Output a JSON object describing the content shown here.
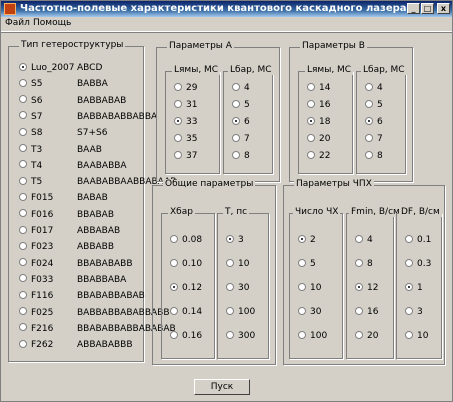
{
  "window": {
    "title": "Частотно-полевые характеристики квантового каскадного лазера",
    "minimize": "_",
    "maximize": "□",
    "close": "x"
  },
  "menu": [
    "Файл",
    "Помощь"
  ],
  "structure": {
    "title": "Тип гетероструктуры",
    "items": [
      {
        "name": "Luo_2007",
        "seq": "ABCD",
        "selected": true
      },
      {
        "name": "S5",
        "seq": "BABBA"
      },
      {
        "name": "S6",
        "seq": "BABBABAB"
      },
      {
        "name": "S7",
        "seq": "BABBABABBABBA"
      },
      {
        "name": "S8",
        "seq": "S7+S6"
      },
      {
        "name": "T3",
        "seq": "BAAB"
      },
      {
        "name": "T4",
        "seq": "BAABABBA"
      },
      {
        "name": "T5",
        "seq": "BAABABBAABBABAAB"
      },
      {
        "name": "F015",
        "seq": "BABAB"
      },
      {
        "name": "F016",
        "seq": "BBABAB"
      },
      {
        "name": "F017",
        "seq": "ABBABAB"
      },
      {
        "name": "F023",
        "seq": "ABBABB"
      },
      {
        "name": "F024",
        "seq": "BBABABABB"
      },
      {
        "name": "F033",
        "seq": "BBABBABA"
      },
      {
        "name": "F116",
        "seq": "BBABABBABAB"
      },
      {
        "name": "F025",
        "seq": "BABBABBABABBABB"
      },
      {
        "name": "F216",
        "seq": "BBABABBABBABABAB"
      },
      {
        "name": "F262",
        "seq": "ABBABABBB"
      }
    ]
  },
  "paramsA": {
    "title": "Параметры A",
    "col1": {
      "label": "Lямы, МС",
      "options": [
        "29",
        "31",
        "33",
        "35",
        "37"
      ],
      "selected": 2
    },
    "col2": {
      "label": "Lбар, МС",
      "options": [
        "4",
        "5",
        "6",
        "7",
        "8"
      ],
      "selected": 2
    }
  },
  "paramsB": {
    "title": "Параметры B",
    "col1": {
      "label": "Lямы, МС",
      "options": [
        "14",
        "16",
        "18",
        "20",
        "22"
      ],
      "selected": 2
    },
    "col2": {
      "label": "Lбар, МС",
      "options": [
        "4",
        "5",
        "6",
        "7",
        "8"
      ],
      "selected": 2
    }
  },
  "common": {
    "title": "Общие параметры",
    "col1": {
      "label": "Xбар",
      "options": [
        "0.08",
        "0.10",
        "0.12",
        "0.14",
        "0.16"
      ],
      "selected": 2
    },
    "col2": {
      "label": "T, пс",
      "options": [
        "3",
        "10",
        "30",
        "100",
        "300"
      ],
      "selected": 0
    }
  },
  "chx": {
    "title": "Параметры ЧПХ",
    "col1": {
      "label": "Число ЧХ",
      "options": [
        "2",
        "5",
        "10",
        "30",
        "100"
      ],
      "selected": 0
    },
    "col2": {
      "label": "Fmin, В/см",
      "options": [
        "4",
        "8",
        "12",
        "16",
        "20"
      ],
      "selected": 2
    },
    "col3": {
      "label": "DF, В/см",
      "options": [
        "0.1",
        "0.3",
        "1",
        "3",
        "10"
      ],
      "selected": 2
    }
  },
  "start_button": "Пуск"
}
